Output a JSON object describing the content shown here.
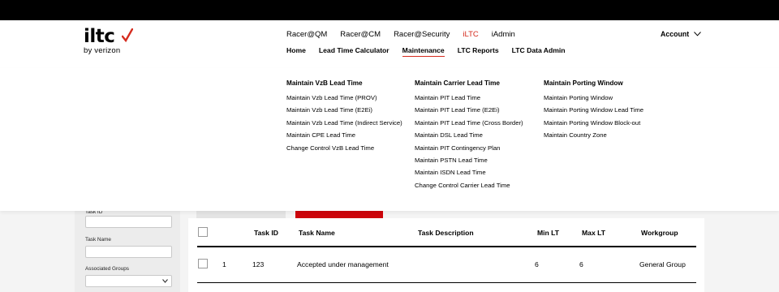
{
  "brand": {
    "logo_text": "iltc",
    "logo_sub": "by verizon",
    "accent": "#d52b1e"
  },
  "nav": {
    "top_items": [
      "Racer@QM",
      "Racer@CM",
      "Racer@Security",
      "iLTC",
      "iAdmin"
    ],
    "top_active_index": 3,
    "main_items": [
      "Home",
      "Lead Time Calculator",
      "Maintenance",
      "LTC Reports",
      "LTC Data Admin"
    ],
    "main_active_index": 2,
    "account_label": "Account"
  },
  "dropdown": {
    "columns": [
      {
        "heading": "Maintain VzB Lead Time",
        "items": [
          "Maintain Vzb Lead Time (PROV)",
          "Maintain Vzb Lead Time (E2Ei)",
          "Maintain Vzb Lead Time (Indirect Service)",
          "Maintain CPE Lead Time",
          "Change Control VzB Lead Time"
        ]
      },
      {
        "heading": "Maintain Carrier Lead Time",
        "items": [
          "Maintain PIT Lead Time",
          "Maintain PIT Lead Time (E2Ei)",
          "Maintain PIT Lead Time (Cross Border)",
          "Maintain DSL Lead Time",
          "Maintain PIT Contingency Plan",
          "Maintain PSTN Lead Time",
          "Maintain ISDN Lead Time",
          "Change Control Carrier Lead Time"
        ]
      },
      {
        "heading": "Maintain Porting Window",
        "items": [
          "Maintain Porting Window",
          "Maintain Porting Window Lead Time",
          "Maintain Porting Window Block-out",
          "Maintain Country Zone"
        ]
      }
    ]
  },
  "filters": {
    "task_id_label": "Task ID",
    "task_name_label": "Task Name",
    "associated_groups_label": "Associated Groups"
  },
  "table": {
    "headers": {
      "task_id": "Task ID",
      "task_name": "Task Name",
      "task_description": "Task Description",
      "min_lt": "Min LT",
      "max_lt": "Max LT",
      "workgroup": "Workgroup"
    },
    "rows": [
      {
        "index": "1",
        "task_id": "123",
        "task_name": "Accepted under management",
        "task_description": "",
        "min_lt": "6",
        "max_lt": "6",
        "workgroup": "General Group"
      }
    ]
  }
}
